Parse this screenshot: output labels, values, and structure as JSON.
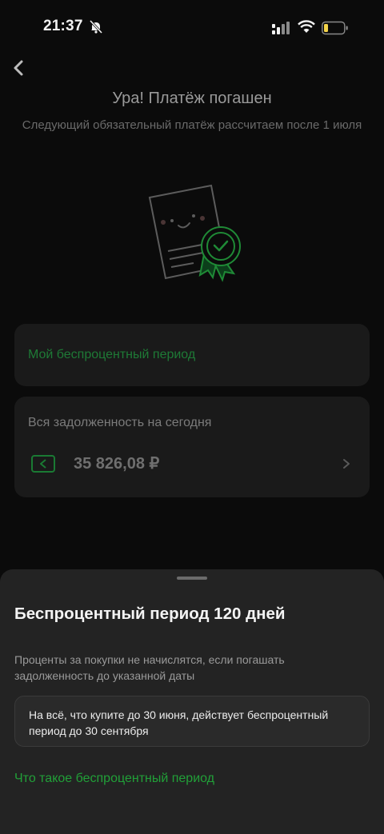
{
  "status_bar": {
    "time": "21:37"
  },
  "header": {
    "title": "Ура! Платёж погашен",
    "subtitle": "Следующий обязательный платёж рассчитаем после 1 июля"
  },
  "period_card": {
    "label": "Мой беспроцентный период"
  },
  "debt_card": {
    "label": "Вся задолженность на сегодня",
    "amount": "35 826,08 ₽"
  },
  "sheet": {
    "title": "Беспроцентный период 120 дней",
    "description": "Проценты за покупки не начислятся, если погашать задолженность до указанной даты",
    "info": "На всё, что купите до 30 июня, действует беспроцентный период до 30 сентября",
    "link": "Что такое беспроцентный период"
  },
  "colors": {
    "accent": "#21a038",
    "background": "#0b0b0b",
    "sheet": "#232323"
  },
  "icons": [
    "bell-off-icon",
    "cellular-signal-icon",
    "wifi-icon",
    "battery-icon",
    "back-arrow-icon",
    "wallet-icon",
    "chevron-right-icon"
  ]
}
